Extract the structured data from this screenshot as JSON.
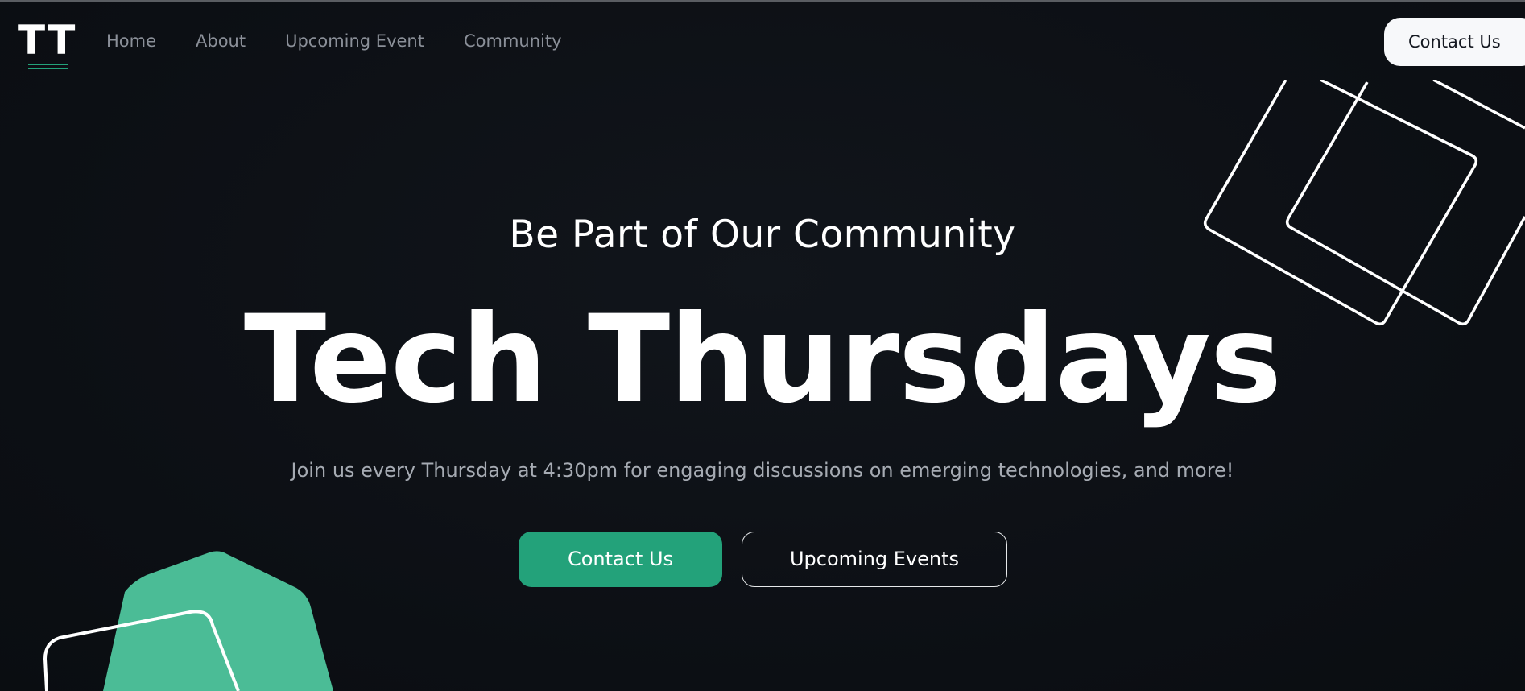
{
  "nav": {
    "logo_text": "TT",
    "links": [
      {
        "label": "Home"
      },
      {
        "label": "About"
      },
      {
        "label": "Upcoming Event"
      },
      {
        "label": "Community"
      }
    ],
    "contact_label": "Contact Us"
  },
  "hero": {
    "subtitle": "Be Part of Our Community",
    "title": "Tech Thursdays",
    "description": "Join us every Thursday at 4:30pm for engaging discussions on emerging technologies, and more!",
    "primary_button": "Contact Us",
    "secondary_button": "Upcoming Events"
  },
  "colors": {
    "background": "#0d1015",
    "accent": "#23a27a",
    "accent_light": "#4bbc96",
    "text_muted": "#8b9099"
  }
}
